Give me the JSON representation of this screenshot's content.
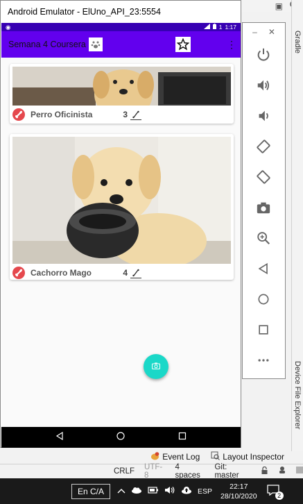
{
  "emulator": {
    "window_title": "Android Emulator - ElUno_API_23:5554"
  },
  "statusbar": {
    "time": "1:17",
    "battery": "1"
  },
  "app": {
    "title": "Semana 4 Coursera"
  },
  "cards": [
    {
      "name": "Perro Oficinista",
      "likes": "3"
    },
    {
      "name": "Cachorro Mago",
      "likes": "4"
    }
  ],
  "ide": {
    "side_tabs": {
      "gradle": "Gradle",
      "device_file_explorer": "Device File Explorer"
    },
    "toolstrip": {
      "event_log": "Event Log",
      "layout_inspector": "Layout Inspector"
    },
    "status": {
      "line_sep": "CRLF",
      "encoding": "UTF-8",
      "indent": "4 spaces",
      "git": "Git: master"
    }
  },
  "taskbar": {
    "input_lang_box": "En C/A",
    "lang": "ESP",
    "time": "22:17",
    "date": "28/10/2020",
    "notifications": "2"
  },
  "colors": {
    "status_bar": "#3700b3",
    "app_bar": "#6200ee",
    "fab": "#1ad8c8",
    "bone_badge": "#e5484d"
  }
}
